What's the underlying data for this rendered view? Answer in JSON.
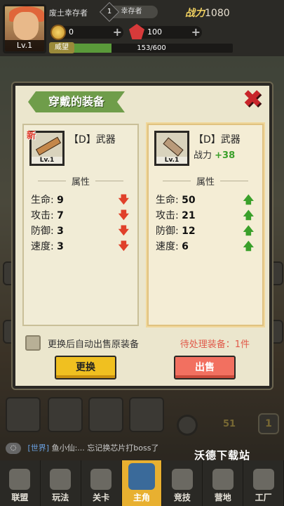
{
  "hud": {
    "player_name": "废土幸存者",
    "level": "Lv.1",
    "rank_num": "1",
    "rank_label": "幸存者",
    "power_label": "战力",
    "power_value": "1080",
    "coins": "0",
    "gems": "100",
    "xp_label": "威望",
    "xp_text": "153/600",
    "xp_fraction": 0.255
  },
  "modal": {
    "title": "穿戴的装备",
    "left": {
      "new_tag": "新",
      "name": "【D】武器",
      "level": "Lv.1",
      "attr_title": "属性",
      "stats": [
        {
          "label": "生命:",
          "value": "9"
        },
        {
          "label": "攻击:",
          "value": "7"
        },
        {
          "label": "防御:",
          "value": "3"
        },
        {
          "label": "速度:",
          "value": "3"
        }
      ]
    },
    "right": {
      "name": "【D】武器",
      "level": "Lv.1",
      "power_label": "战力",
      "power_delta": "+38",
      "attr_title": "属性",
      "stats": [
        {
          "label": "生命:",
          "value": "50"
        },
        {
          "label": "攻击:",
          "value": "21"
        },
        {
          "label": "防御:",
          "value": "12"
        },
        {
          "label": "速度:",
          "value": "6"
        }
      ]
    },
    "auto_sell_label": "更换后自动出售原装备",
    "pending_label": "待处理装备：1件",
    "replace_button": "更换",
    "sell_button": "出售"
  },
  "chat": {
    "channel": "[世界]",
    "message": "鱼小仙:...  忘记换芯片打boss了"
  },
  "watermark": "沃德下载站",
  "nav": [
    "联盟",
    "玩法",
    "关卡",
    "主角",
    "竞技",
    "营地",
    "工厂"
  ],
  "scene": {
    "level_counter": "51",
    "badge_num": "1"
  }
}
